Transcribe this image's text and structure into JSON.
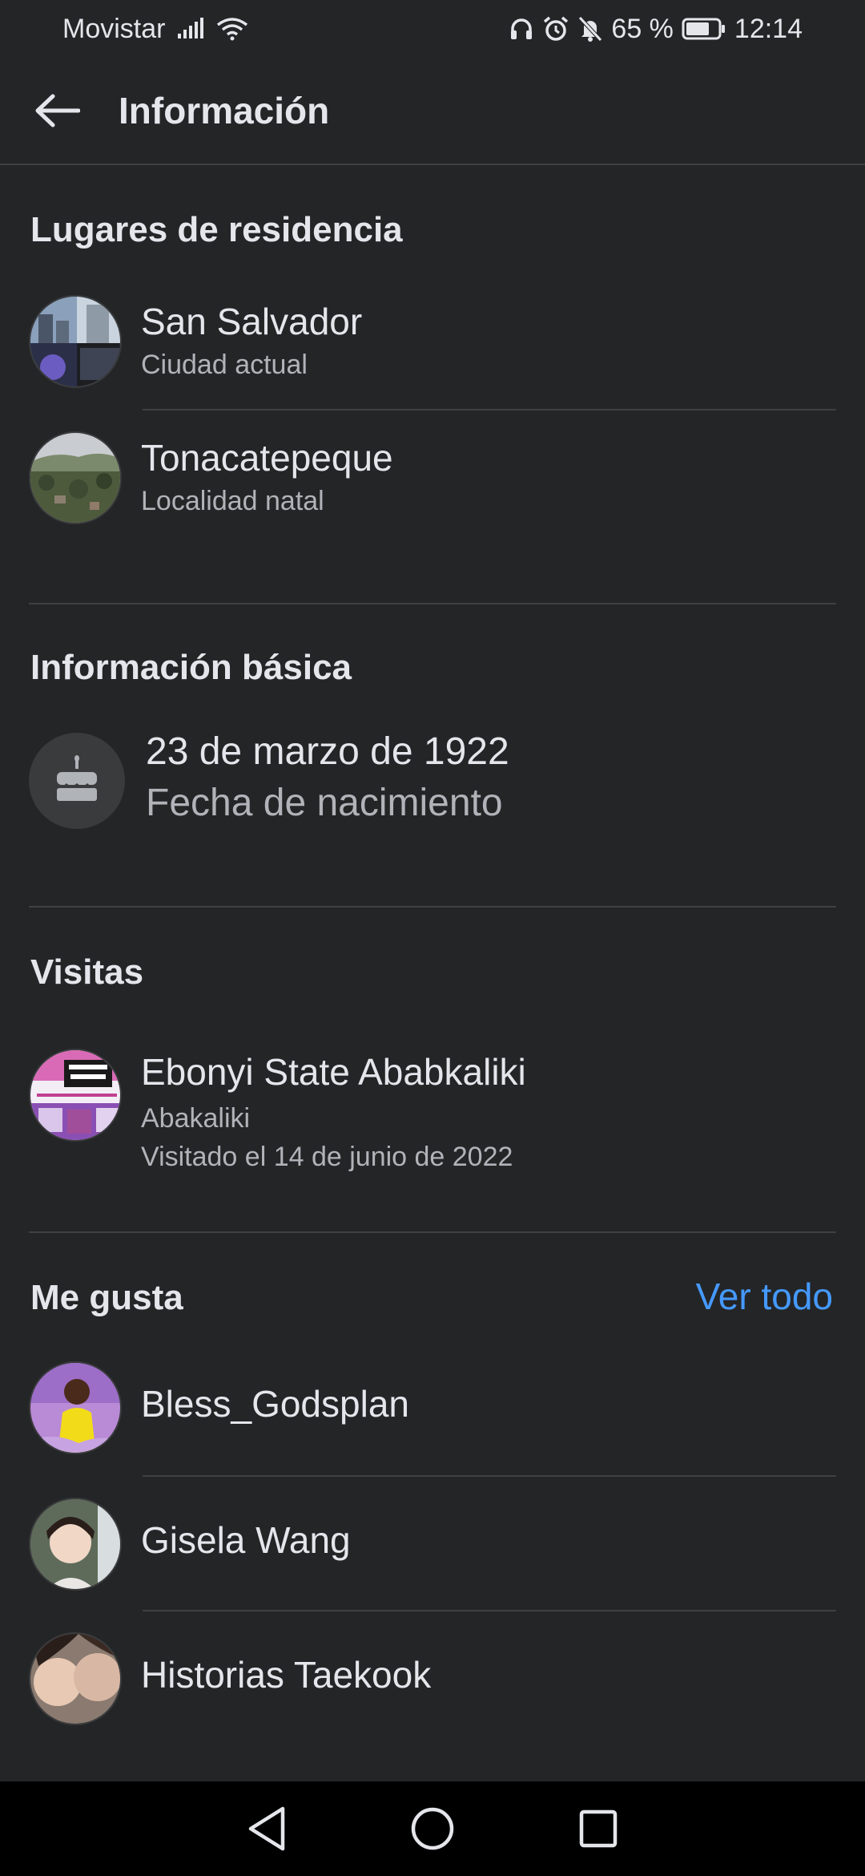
{
  "status_bar": {
    "carrier": "Movistar",
    "battery_percent": "65 %",
    "time": "12:14",
    "icons": [
      "signal-icon",
      "wifi-icon",
      "headphones-icon",
      "alarm-icon",
      "mute-icon",
      "battery-icon"
    ]
  },
  "header": {
    "title": "Información"
  },
  "residence": {
    "title": "Lugares de residencia",
    "items": [
      {
        "name": "San Salvador",
        "subtitle": "Ciudad actual"
      },
      {
        "name": "Tonacatepeque",
        "subtitle": "Localidad natal"
      }
    ]
  },
  "basic": {
    "title": "Información básica",
    "birthday": "23 de marzo de 1922",
    "birthday_label": "Fecha de nacimiento"
  },
  "visits": {
    "title": "Visitas",
    "items": [
      {
        "name": "Ebonyi State Ababkaliki",
        "city": "Abakaliki",
        "date": "Visitado el 14 de junio de 2022"
      }
    ]
  },
  "likes": {
    "title": "Me gusta",
    "see_all": "Ver todo",
    "items": [
      {
        "name": "Bless_Godsplan"
      },
      {
        "name": "Gisela Wang"
      },
      {
        "name": "Historias Taekook"
      }
    ]
  },
  "colors": {
    "background": "#242527",
    "divider": "#3e4042",
    "link": "#4599ff",
    "secondary_text": "#b0b3b8"
  }
}
